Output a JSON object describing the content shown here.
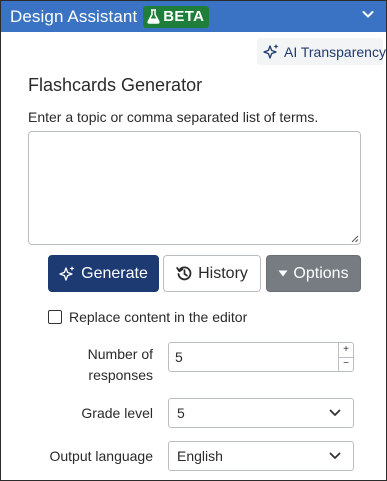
{
  "header": {
    "title": "Design Assistant",
    "badge": "BETA",
    "colors": {
      "bar": "#3b73c4",
      "badge": "#1f7f3a"
    }
  },
  "ai_transparency": {
    "label": "AI Transparency",
    "icon": "sparkle-icon"
  },
  "generator": {
    "title": "Flashcards Generator",
    "instructions": "Enter a topic or comma separated list of terms.",
    "topic_value": ""
  },
  "actions": {
    "generate_label": "Generate",
    "history_label": "History",
    "options_label": "Options",
    "colors": {
      "generate": "#1d3b72",
      "options": "#777c83"
    }
  },
  "replace_content": {
    "label": "Replace content in the editor",
    "checked": false
  },
  "fields": {
    "responses": {
      "label": "Number of responses",
      "value": "5"
    },
    "grade": {
      "label": "Grade level",
      "value": "5"
    },
    "language": {
      "label": "Output language",
      "value": "English"
    }
  }
}
